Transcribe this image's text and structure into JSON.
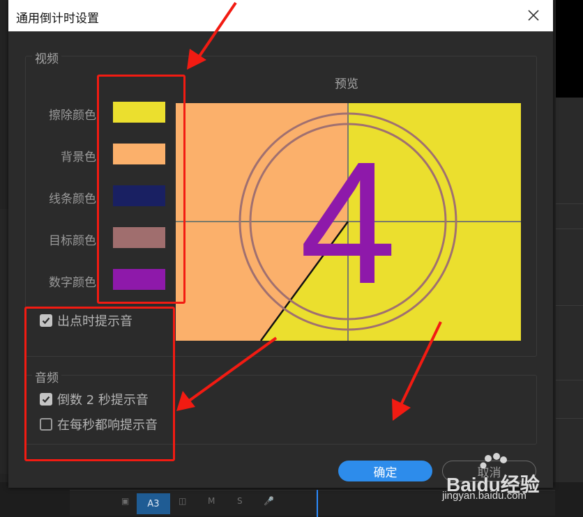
{
  "dialog": {
    "title": "通用倒计时设置",
    "close_icon": "close-icon"
  },
  "video": {
    "legend": "视频",
    "preview_label": "预览",
    "colors": [
      {
        "label": "擦除颜色",
        "color": "#ebdf2e"
      },
      {
        "label": "背景色",
        "color": "#fbb06b"
      },
      {
        "label": "线条颜色",
        "color": "#192062"
      },
      {
        "label": "目标颜色",
        "color": "#a06e6e"
      },
      {
        "label": "数字颜色",
        "color": "#8e19aa"
      }
    ],
    "cue_checkbox": {
      "label": "出点时提示音",
      "checked": true
    },
    "preview": {
      "number": "4"
    }
  },
  "audio": {
    "legend": "音频",
    "checkboxes": [
      {
        "label": "倒数 2 秒提示音",
        "checked": true
      },
      {
        "label": "在每秒都响提示音",
        "checked": false
      }
    ]
  },
  "buttons": {
    "ok": "确定",
    "cancel": "取消"
  },
  "timeline": {
    "track_label": "A3",
    "mute": "M",
    "solo": "S"
  },
  "watermark": {
    "brand": "Baidu经验",
    "url": "jingyan.baidu.com"
  },
  "accent_color": "#2d8ceb",
  "annotation_color": "#f21b12"
}
